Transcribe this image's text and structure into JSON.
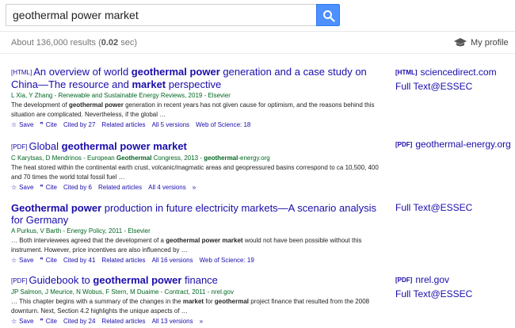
{
  "search": {
    "query": "geothermal power market"
  },
  "stats": {
    "prefix": "About 136,000 results (",
    "time": "0.02",
    "suffix": " sec)"
  },
  "profile": {
    "label": "My profile"
  },
  "results": [
    {
      "tag": "[HTML]",
      "title_parts": [
        {
          "t": "An overview of world ",
          "b": false
        },
        {
          "t": "geothermal power",
          "b": true
        },
        {
          "t": " generation and a case study on China—The resource and ",
          "b": false
        },
        {
          "t": "market",
          "b": true
        },
        {
          "t": " perspective",
          "b": false
        }
      ],
      "meta": "L Xia, Y Zhang - Renewable and Sustainable Energy Reviews, 2019 - Elsevier",
      "snippet_parts": [
        {
          "t": "The development of ",
          "b": false
        },
        {
          "t": "geothermal power",
          "b": true
        },
        {
          "t": " generation in recent years has not given cause for optimism, and the reasons behind this situation are complicated. Nevertheless, if the global …",
          "b": false
        }
      ],
      "actions": [
        "Save",
        "Cite",
        "Cited by 27",
        "Related articles",
        "All 5 versions",
        "Web of Science: 18"
      ]
    },
    {
      "tag": "[PDF]",
      "title_parts": [
        {
          "t": "Global ",
          "b": false
        },
        {
          "t": "geothermal power market",
          "b": true
        }
      ],
      "meta_parts": [
        {
          "t": "C Karytsas, D Mendrinos - European ",
          "b": false
        },
        {
          "t": "Geothermal",
          "b": true
        },
        {
          "t": " Congress, 2013 - ",
          "b": false
        },
        {
          "t": "geothermal",
          "b": true
        },
        {
          "t": "-energy.org",
          "b": false
        }
      ],
      "snippet": "The heat stored within the continental earth crust, volcanic/magmatic areas and geopressured basins correspond to ca 10,500, 400 and 70 times the world total fossil fuel …",
      "actions": [
        "Save",
        "Cite",
        "Cited by 6",
        "Related articles",
        "All 4 versions",
        "»"
      ]
    },
    {
      "tag": "",
      "title_parts": [
        {
          "t": "Geothermal power",
          "b": true
        },
        {
          "t": " production in future electricity markets—A scenario analysis for Germany",
          "b": false
        }
      ],
      "meta": "A Purkus, V Barth - Energy Policy, 2011 - Elsevier",
      "snippet_parts": [
        {
          "t": "… Both interviewees agreed that the development of a ",
          "b": false
        },
        {
          "t": "geothermal power market",
          "b": true
        },
        {
          "t": " would not have been possible without this instrument. However, price incentives are also influenced by …",
          "b": false
        }
      ],
      "actions": [
        "Save",
        "Cite",
        "Cited by 41",
        "Related articles",
        "All 16 versions",
        "Web of Science: 19"
      ]
    },
    {
      "tag": "[PDF]",
      "title_parts": [
        {
          "t": "Guidebook to ",
          "b": false
        },
        {
          "t": "geothermal power",
          "b": true
        },
        {
          "t": " finance",
          "b": false
        }
      ],
      "meta": "JP Salmon, J Meurice, N Wobus, F Stern, M Duaime - Contract, 2011 - nrel.gov",
      "snippet_parts": [
        {
          "t": "… This chapter begins with a summary of the changes in the ",
          "b": false
        },
        {
          "t": "market",
          "b": true
        },
        {
          "t": " for ",
          "b": false
        },
        {
          "t": "geothermal",
          "b": true
        },
        {
          "t": " project finance that resulted from the 2008 downturn. Next, Section 4.2 highlights the unique aspects of …",
          "b": false
        }
      ],
      "actions": [
        "Save",
        "Cite",
        "Cited by 24",
        "Related articles",
        "All 13 versions",
        "»"
      ]
    }
  ],
  "side_links": [
    [
      {
        "tag": "[HTML]",
        "text": "sciencedirect.com"
      },
      {
        "tag": "",
        "text": "Full Text@ESSEC"
      }
    ],
    [
      {
        "tag": "[PDF]",
        "text": "geothermal-energy.org"
      }
    ],
    [
      {
        "tag": "",
        "text": "Full Text@ESSEC"
      }
    ],
    [
      {
        "tag": "[PDF]",
        "text": "nrel.gov"
      },
      {
        "tag": "",
        "text": "Full Text@ESSEC"
      }
    ]
  ],
  "icons": {
    "search": "search-icon",
    "profile": "graduation-cap-icon",
    "save": "star-icon",
    "cite": "quote-icon",
    "more": "double-chevron-icon"
  },
  "colors": {
    "link": "#1a0dab",
    "meta": "#006621",
    "search_button": "#4d90fe"
  }
}
